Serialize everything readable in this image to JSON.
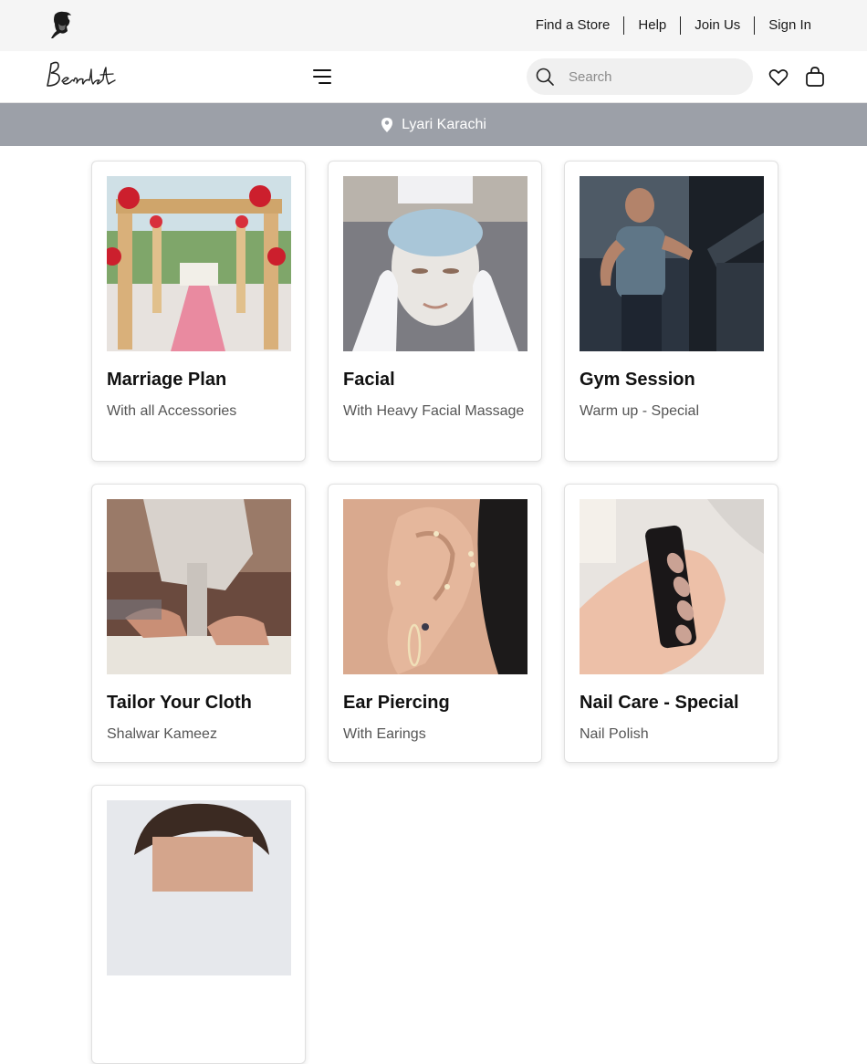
{
  "header": {
    "links": [
      "Find a Store",
      "Help",
      "Join Us",
      "Sign In"
    ]
  },
  "nav": {
    "logo_text": "Bendat",
    "search": {
      "placeholder": "Search",
      "value": ""
    }
  },
  "location": {
    "label": "Lyari Karachi"
  },
  "services": [
    {
      "title": "Marriage Plan",
      "subtitle": "With all Accessories"
    },
    {
      "title": "Facial",
      "subtitle": "With Heavy Facial Massage"
    },
    {
      "title": "Gym Session",
      "subtitle": "Warm up - Special"
    },
    {
      "title": "Tailor Your Cloth",
      "subtitle": "Shalwar Kameez"
    },
    {
      "title": "Ear Piercing",
      "subtitle": "With Earings"
    },
    {
      "title": "Nail Care - Special",
      "subtitle": "Nail Polish"
    },
    {
      "title": "",
      "subtitle": ""
    }
  ],
  "colors": {
    "utility_bg": "#f5f5f5",
    "location_bg": "#9ca0a8",
    "search_bg": "#f0f0f0"
  }
}
